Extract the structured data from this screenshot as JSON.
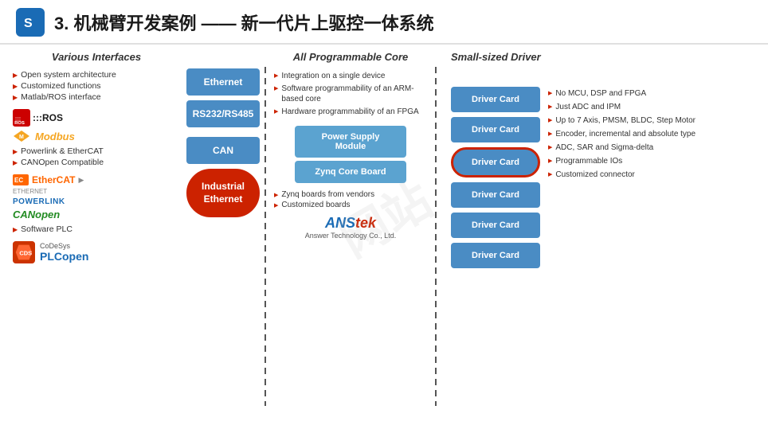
{
  "header": {
    "title": "3. 机械臂开发案例 —— 新一代片上驱控一体系统",
    "icon_label": "S"
  },
  "left_col": {
    "title": "Various Interfaces",
    "features": [
      "Open system architecture",
      "Customized functions",
      "Matlab/ROS interface"
    ],
    "ros_label": ":::ROS",
    "modbus_label": "Modbus",
    "more_features": [
      "Powerlink & EtherCAT",
      "CANOpen Compatible"
    ],
    "ethercat_label": "EtherCAT",
    "ethernet_label": "ETHERNET",
    "powerlink_label": "POWERLINK",
    "canopen_label": "CANopen",
    "software_plc_label": "Software PLC",
    "codesys_label": "CoDeSys",
    "plcopen_label": "PLCopen"
  },
  "interface_buttons": [
    {
      "label": "Ethernet",
      "style": "normal"
    },
    {
      "label": "RS232/RS485",
      "style": "normal"
    },
    {
      "label": "CAN",
      "style": "normal"
    },
    {
      "label": "Industrial\nEthernet",
      "style": "industrial"
    }
  ],
  "middle_col": {
    "title": "All Programmable Core",
    "features": [
      "Integration on a single device",
      "Software programmability of an ARM-based core",
      "Hardware programmability of an FPGA"
    ],
    "power_supply_label": "Power Supply\nModule",
    "zynq_label": "Zynq Core Board",
    "extra_features": [
      "Zynq boards from vendors",
      "Customized boards"
    ],
    "anstek_name": "ANStek",
    "anstek_sub": "Answer Technology Co., Ltd."
  },
  "driver_col": {
    "title": "Small-sized Driver",
    "cards": [
      {
        "label": "Driver Card",
        "highlighted": false
      },
      {
        "label": "Driver Card",
        "highlighted": false
      },
      {
        "label": "Driver Card",
        "highlighted": true
      },
      {
        "label": "Driver Card",
        "highlighted": false
      },
      {
        "label": "Driver Card",
        "highlighted": false
      },
      {
        "label": "Driver Card",
        "highlighted": false
      }
    ],
    "features": [
      "No MCU, DSP and FPGA",
      "Just ADC and IPM",
      "Up to 7 Axis, PMSM, BLDC, Step Motor",
      "Encoder, incremental and absolute type",
      "ADC, SAR and Sigma-delta",
      "Programmable IOs",
      "Customized connector"
    ]
  }
}
